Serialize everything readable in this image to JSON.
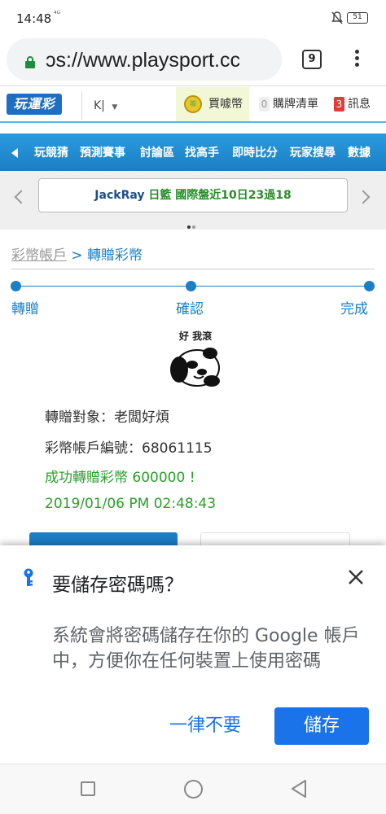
{
  "status": {
    "time": "14:48",
    "signal": "⁴ᴳ",
    "battery": "51"
  },
  "browser": {
    "url": "ɔs://www.playsport.cc",
    "tab_count": "9"
  },
  "site": {
    "logo_text": "玩運彩",
    "user_select": "K|",
    "buy_coins": "買噱幣",
    "cart_count": "0",
    "cart_label": "購牌清單",
    "msg_count": "3",
    "msg_label": "訊息"
  },
  "nav": {
    "items": [
      "玩競猜",
      "預測賽事",
      "討論區",
      "找高手",
      "即時比分",
      "玩家搜尋",
      "數據"
    ]
  },
  "marquee": {
    "name": "JackRay",
    "text": "日籃 國際盤近10日23過18"
  },
  "breadcrumb": {
    "parent": "彩幣帳戶",
    "separator": ">",
    "current": "轉贈彩幣"
  },
  "steps": [
    "轉贈",
    "確認",
    "完成"
  ],
  "sticker": {
    "caption": "好 我滾"
  },
  "result": {
    "target_line": "轉贈對象：老闆好煩",
    "account_line": "彩幣帳戶編號：68061115",
    "success_line": "成功轉贈彩幣 600000 !",
    "datetime": "2019/01/06 PM 02:48:43"
  },
  "save_password_sheet": {
    "title": "要儲存密碼嗎？",
    "body": "系統會將密碼儲存在你的 Google 帳戶中，方便你在任何裝置上使用密碼",
    "never_label": "一律不要",
    "save_label": "儲存"
  }
}
